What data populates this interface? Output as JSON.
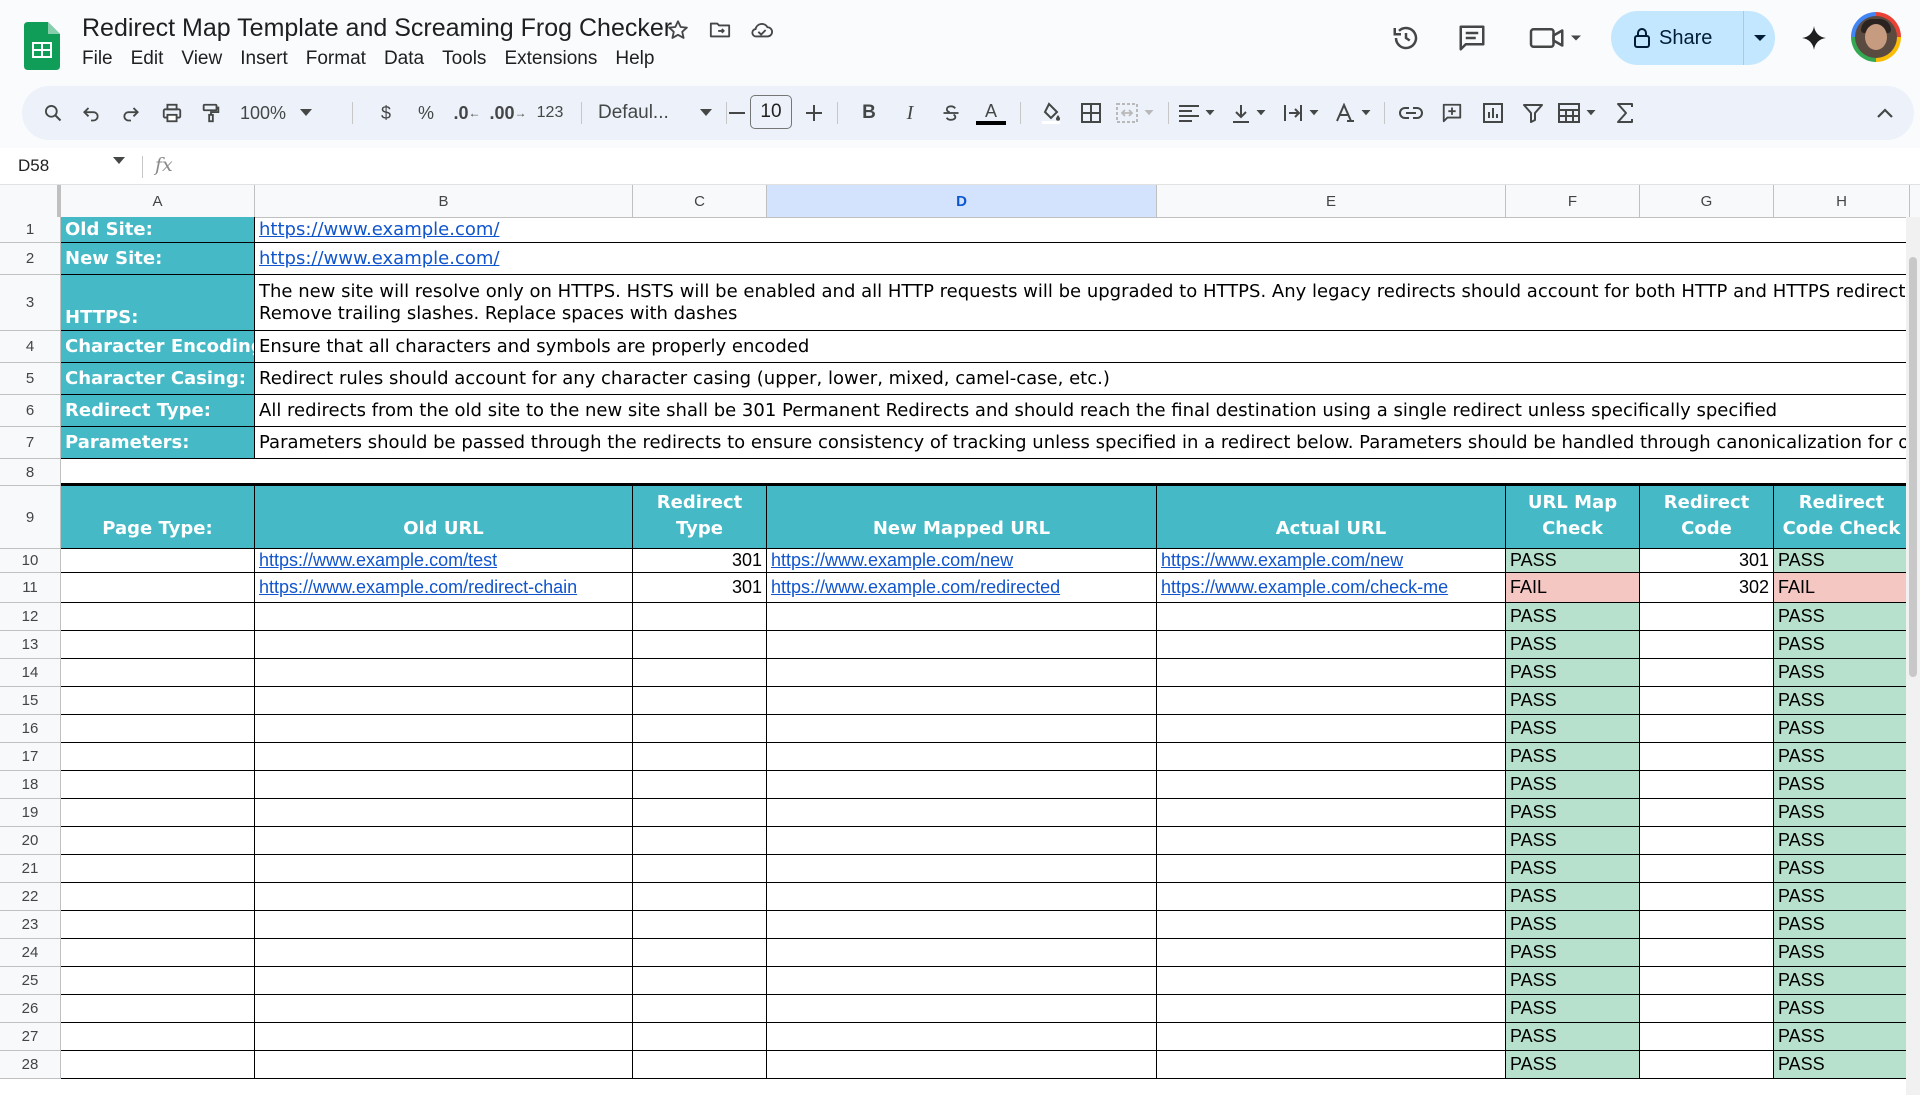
{
  "window": {
    "title": "Redirect Map Template and Screaming Frog Checker",
    "share_label": "Share"
  },
  "menu": [
    "File",
    "Edit",
    "View",
    "Insert",
    "Format",
    "Data",
    "Tools",
    "Extensions",
    "Help"
  ],
  "toolbar": {
    "zoom": "100%",
    "currency": "$",
    "percent": "%",
    "decrease_decimal": ".0",
    "increase_decimal": ".00",
    "number_format": "123",
    "font": "Defaul...",
    "font_size": "10",
    "bold": "B",
    "italic": "I",
    "text_color": "A"
  },
  "formula_bar": {
    "name_box": "D58",
    "fx": "fx"
  },
  "columns": [
    "A",
    "B",
    "C",
    "D",
    "E",
    "F",
    "G",
    "H"
  ],
  "selected_column": "D",
  "rows": [
    "1",
    "2",
    "3",
    "4",
    "5",
    "6",
    "7",
    "8",
    "9",
    "10",
    "11",
    "12",
    "13",
    "14",
    "15",
    "16",
    "17",
    "18",
    "19",
    "20",
    "21",
    "22",
    "23",
    "24",
    "25",
    "26",
    "27",
    "28"
  ],
  "settings": [
    {
      "label": "Old Site:",
      "value": "https://www.example.com/",
      "is_link": true
    },
    {
      "label": "New Site:",
      "value": "https://www.example.com/",
      "is_link": true
    },
    {
      "label": "HTTPS:",
      "value": "The new site will resolve only on HTTPS. HSTS will be enabled and all HTTP requests will be upgraded to HTTPS. Any legacy redirects should account for both HTTP and HTTPS redirects as well as",
      "value2": "Remove trailing slashes. Replace spaces with dashes",
      "is_link": false
    },
    {
      "label": "Character Encoding:",
      "value": "Ensure that all characters and symbols are properly encoded",
      "is_link": false
    },
    {
      "label": "Character Casing:",
      "value": "Redirect rules should account for any character casing (upper, lower, mixed, camel-case, etc.)",
      "is_link": false
    },
    {
      "label": "Redirect Type:",
      "value": "All redirects from the old site to the new site shall be 301 Permanent Redirects and should reach the final destination using a single redirect unless specifically specified",
      "is_link": false
    },
    {
      "label": "Parameters:",
      "value": "Parameters should be passed through the redirects to ensure consistency of tracking unless specified in a redirect below. Parameters should be handled through canonicalization for organic pur",
      "is_link": false
    }
  ],
  "table_headers": {
    "page_type": "Page Type:",
    "old_url": "Old URL",
    "redirect_type": "Redirect Type",
    "new_mapped_url": "New Mapped URL",
    "actual_url": "Actual URL",
    "url_map_check": "URL Map Check",
    "primary_redirect_code": "Primary Redirect Code",
    "redirect_code_check": "Redirect Code Check"
  },
  "table_rows": [
    {
      "page_type": "",
      "old_url": "https://www.example.com/test",
      "redirect_type": "301",
      "new_mapped_url": "https://www.example.com/new",
      "actual_url": "https://www.example.com/new",
      "url_map_check": "PASS",
      "primary_redirect_code": "301",
      "redirect_code_check": "PASS"
    },
    {
      "page_type": "",
      "old_url": "https://www.example.com/redirect-chain",
      "redirect_type": "301",
      "new_mapped_url": "https://www.example.com/redirected",
      "actual_url": "https://www.example.com/check-me",
      "url_map_check": "FAIL",
      "primary_redirect_code": "302",
      "redirect_code_check": "FAIL"
    },
    {
      "page_type": "",
      "old_url": "",
      "redirect_type": "",
      "new_mapped_url": "",
      "actual_url": "",
      "url_map_check": "PASS",
      "primary_redirect_code": "",
      "redirect_code_check": "PASS"
    },
    {
      "page_type": "",
      "old_url": "",
      "redirect_type": "",
      "new_mapped_url": "",
      "actual_url": "",
      "url_map_check": "PASS",
      "primary_redirect_code": "",
      "redirect_code_check": "PASS"
    },
    {
      "page_type": "",
      "old_url": "",
      "redirect_type": "",
      "new_mapped_url": "",
      "actual_url": "",
      "url_map_check": "PASS",
      "primary_redirect_code": "",
      "redirect_code_check": "PASS"
    },
    {
      "page_type": "",
      "old_url": "",
      "redirect_type": "",
      "new_mapped_url": "",
      "actual_url": "",
      "url_map_check": "PASS",
      "primary_redirect_code": "",
      "redirect_code_check": "PASS"
    },
    {
      "page_type": "",
      "old_url": "",
      "redirect_type": "",
      "new_mapped_url": "",
      "actual_url": "",
      "url_map_check": "PASS",
      "primary_redirect_code": "",
      "redirect_code_check": "PASS"
    },
    {
      "page_type": "",
      "old_url": "",
      "redirect_type": "",
      "new_mapped_url": "",
      "actual_url": "",
      "url_map_check": "PASS",
      "primary_redirect_code": "",
      "redirect_code_check": "PASS"
    },
    {
      "page_type": "",
      "old_url": "",
      "redirect_type": "",
      "new_mapped_url": "",
      "actual_url": "",
      "url_map_check": "PASS",
      "primary_redirect_code": "",
      "redirect_code_check": "PASS"
    },
    {
      "page_type": "",
      "old_url": "",
      "redirect_type": "",
      "new_mapped_url": "",
      "actual_url": "",
      "url_map_check": "PASS",
      "primary_redirect_code": "",
      "redirect_code_check": "PASS"
    },
    {
      "page_type": "",
      "old_url": "",
      "redirect_type": "",
      "new_mapped_url": "",
      "actual_url": "",
      "url_map_check": "PASS",
      "primary_redirect_code": "",
      "redirect_code_check": "PASS"
    },
    {
      "page_type": "",
      "old_url": "",
      "redirect_type": "",
      "new_mapped_url": "",
      "actual_url": "",
      "url_map_check": "PASS",
      "primary_redirect_code": "",
      "redirect_code_check": "PASS"
    },
    {
      "page_type": "",
      "old_url": "",
      "redirect_type": "",
      "new_mapped_url": "",
      "actual_url": "",
      "url_map_check": "PASS",
      "primary_redirect_code": "",
      "redirect_code_check": "PASS"
    },
    {
      "page_type": "",
      "old_url": "",
      "redirect_type": "",
      "new_mapped_url": "",
      "actual_url": "",
      "url_map_check": "PASS",
      "primary_redirect_code": "",
      "redirect_code_check": "PASS"
    },
    {
      "page_type": "",
      "old_url": "",
      "redirect_type": "",
      "new_mapped_url": "",
      "actual_url": "",
      "url_map_check": "PASS",
      "primary_redirect_code": "",
      "redirect_code_check": "PASS"
    },
    {
      "page_type": "",
      "old_url": "",
      "redirect_type": "",
      "new_mapped_url": "",
      "actual_url": "",
      "url_map_check": "PASS",
      "primary_redirect_code": "",
      "redirect_code_check": "PASS"
    },
    {
      "page_type": "",
      "old_url": "",
      "redirect_type": "",
      "new_mapped_url": "",
      "actual_url": "",
      "url_map_check": "PASS",
      "primary_redirect_code": "",
      "redirect_code_check": "PASS"
    },
    {
      "page_type": "",
      "old_url": "",
      "redirect_type": "",
      "new_mapped_url": "",
      "actual_url": "",
      "url_map_check": "PASS",
      "primary_redirect_code": "",
      "redirect_code_check": "PASS"
    },
    {
      "page_type": "",
      "old_url": "",
      "redirect_type": "",
      "new_mapped_url": "",
      "actual_url": "",
      "url_map_check": "PASS",
      "primary_redirect_code": "",
      "redirect_code_check": "PASS"
    }
  ],
  "colors": {
    "header_teal": "#45b9c5",
    "pass_fill": "#b7e1cd",
    "fail_fill": "#f4c7c3",
    "link": "#1155cc",
    "share_button": "#c2e7ff"
  }
}
